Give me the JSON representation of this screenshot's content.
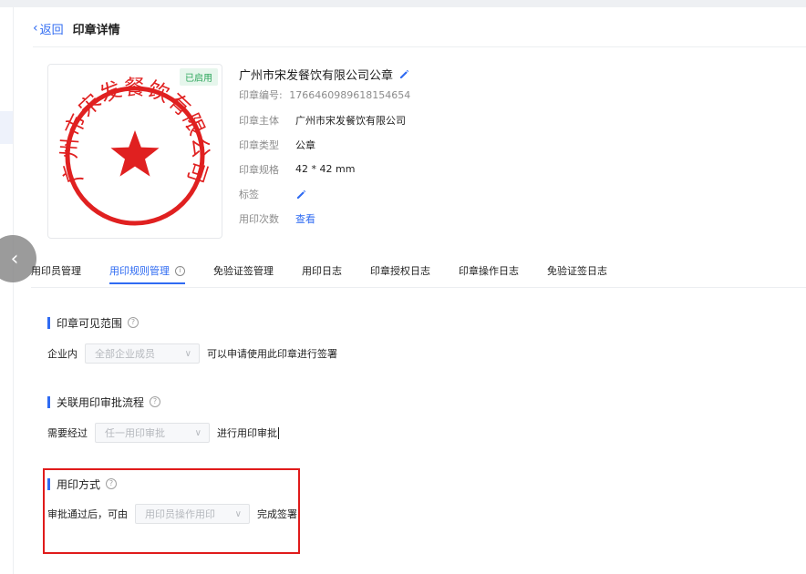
{
  "header": {
    "back_label": "返回",
    "title": "印章详情"
  },
  "seal": {
    "status": "已启用",
    "name": "广州市宋发餐饮有限公司公章",
    "code_label": "印章编号:",
    "code_value": "1766460989618154654",
    "stamp_text": "广州市宋发餐饮有限公司",
    "colors": {
      "stamp": "#e02020"
    },
    "fields": [
      {
        "label": "印章主体",
        "value": "广州市宋发餐饮有限公司"
      },
      {
        "label": "印章类型",
        "value": "公章"
      },
      {
        "label": "印章规格",
        "value": "42 * 42 mm"
      },
      {
        "label": "标签",
        "value": ""
      },
      {
        "label": "用印次数",
        "value": "查看"
      }
    ]
  },
  "tabs": [
    {
      "label": "用印员管理"
    },
    {
      "label": "用印规则管理"
    },
    {
      "label": "免验证签管理"
    },
    {
      "label": "用印日志"
    },
    {
      "label": "印章授权日志"
    },
    {
      "label": "印章操作日志"
    },
    {
      "label": "免验证签日志"
    }
  ],
  "sections": {
    "visibility": {
      "title": "印章可见范围",
      "prefix": "企业内",
      "select_value": "全部企业成员",
      "suffix": "可以申请使用此印章进行签署"
    },
    "approval": {
      "title": "关联用印审批流程",
      "prefix": "需要经过",
      "select_value": "任一用印审批",
      "suffix": "进行用印审批"
    },
    "usage": {
      "title": "用印方式",
      "prefix": "审批通过后，可由",
      "select_value": "用印员操作用印",
      "suffix": "完成签署"
    }
  },
  "colors": {
    "accent": "#2f6bf2",
    "success": "#2da65c",
    "highlight": "#e01b1b"
  }
}
